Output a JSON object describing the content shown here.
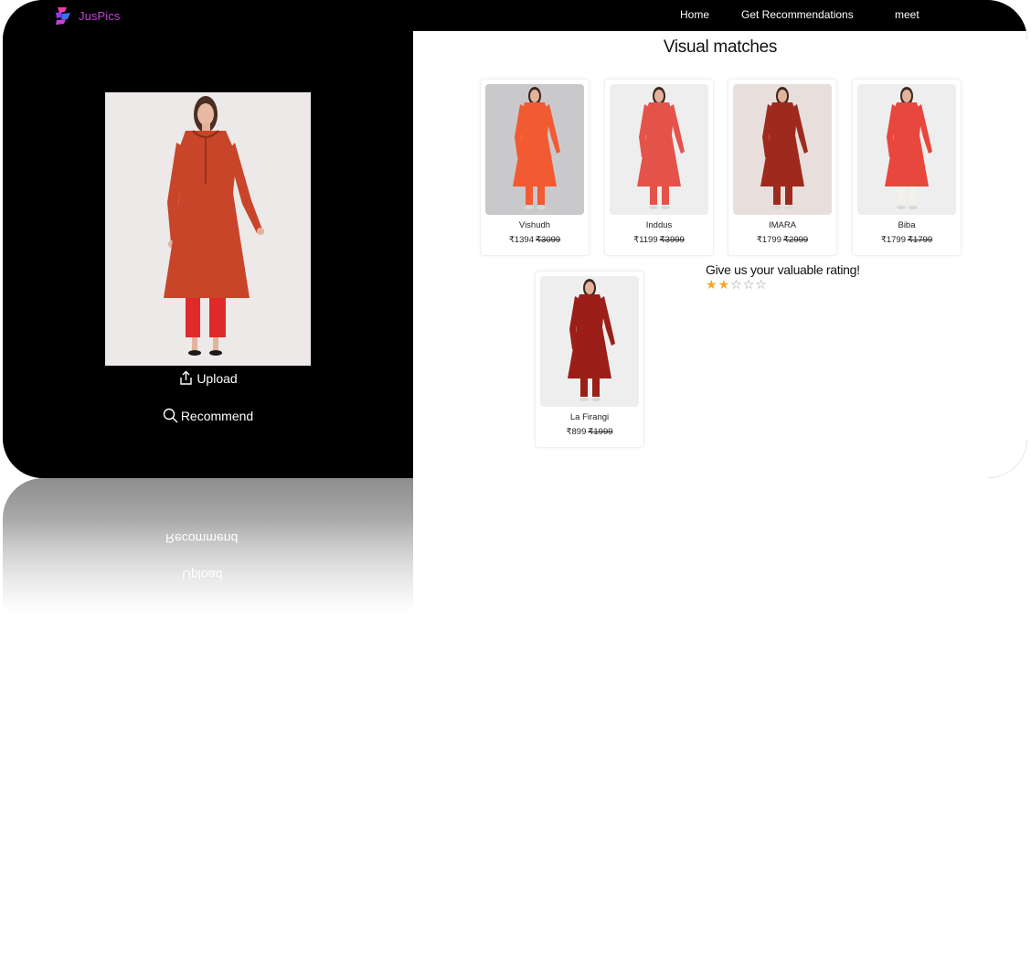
{
  "nav": {
    "brand": "JusPics",
    "links": [
      "Home",
      "Get Recommendations",
      "meet"
    ]
  },
  "upload_panel": {
    "upload_label": "Upload",
    "recommend_label": "Recommend"
  },
  "matches": {
    "title": "Visual matches",
    "products": [
      {
        "brand": "Vishudh",
        "price": "₹1394",
        "mrp": "₹3099",
        "dress_color": "#f25a32"
      },
      {
        "brand": "Inddus",
        "price": "₹1199",
        "mrp": "₹3999",
        "dress_color": "#e4534a"
      },
      {
        "brand": "IMARA",
        "price": "₹1799",
        "mrp": "₹2999",
        "dress_color": "#9e2a1e"
      },
      {
        "brand": "Biba",
        "price": "₹1799",
        "mrp": "₹1799",
        "dress_color": "#e8473d"
      },
      {
        "brand": "La Firangi",
        "price": "₹899",
        "mrp": "₹1999",
        "dress_color": "#9c1e18"
      }
    ]
  },
  "rating": {
    "title": "Give us your valuable rating!",
    "value": 2,
    "max": 5
  },
  "colors": {
    "brand": "#c542d8",
    "star": "#f5a623",
    "uploaded_dress": "#c8452a"
  }
}
